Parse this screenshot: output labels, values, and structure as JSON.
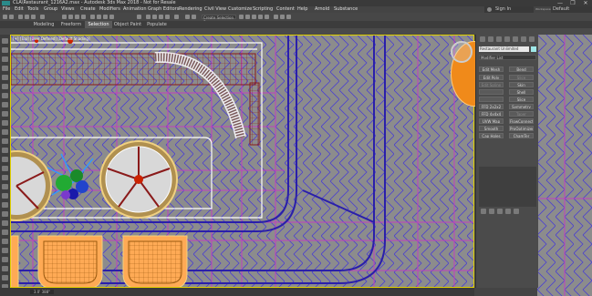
{
  "window": {
    "title": "CLA\\Restaurant_1216A2.max - Autodesk 3ds Max 2018 - Not for Resale",
    "controls": [
      "—",
      "❐",
      "✕"
    ]
  },
  "menu": [
    "File",
    "Edit",
    "Tools",
    "Group",
    "Views",
    "Create",
    "Modifiers",
    "Animation",
    "Graph Editors",
    "Rendering",
    "Civil View",
    "Customize",
    "Scripting",
    "Content",
    "Help",
    "Arnold",
    "Substance"
  ],
  "account": {
    "signin": "Sign In",
    "workspaces_label": "Workspaces:",
    "workspace": "Default"
  },
  "toolbar": {
    "selection_set": "Create Selection Se"
  },
  "ribbon_tabs": [
    "Modeling",
    "Freeform",
    "Selection",
    "Object Paint",
    "Populate"
  ],
  "ribbon_active": "Selection",
  "viewport": {
    "label": "[+] [Top] [User Defined] [Default Shading]"
  },
  "command_panel": {
    "object_name": "Restaurant Unlimited",
    "modifier_list": "Modifier List",
    "modifier_buttons": [
      [
        "Edit Mesh",
        "Bend"
      ],
      [
        "Edit Poly",
        "Slice"
      ],
      [
        "Edit Spline",
        "Skin"
      ],
      [
        "",
        "Shell"
      ],
      [
        "",
        "Slice"
      ],
      [
        "FFD 2x2x2",
        "Symmetry"
      ],
      [
        "FFD 4x4x4",
        "Taper"
      ],
      [
        "UVW Map",
        "FlowConnector"
      ],
      [
        "Smooth",
        "ProOptimizer"
      ],
      [
        "Cap Holes",
        "ChamTer"
      ]
    ]
  },
  "status": {
    "coord": "3.0' 388\""
  },
  "colors": {
    "viewport_bg": "#8c8c8c",
    "grid": "#c040c0",
    "pattern": "#4a3fd0",
    "active_border": "#e0d000",
    "furniture": "#cc2200",
    "orange": "#f08a1a"
  }
}
